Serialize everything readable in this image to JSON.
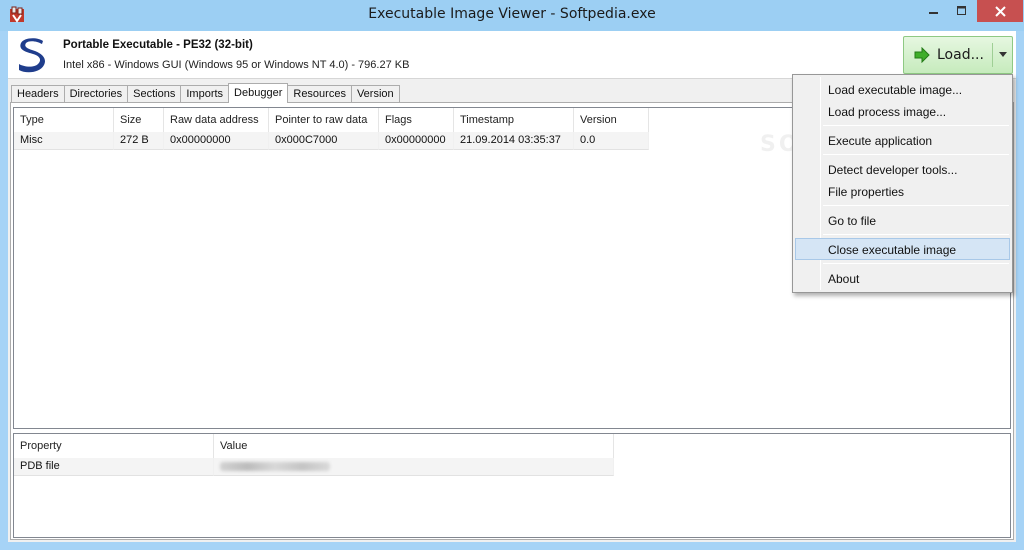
{
  "window": {
    "title": "Executable Image Viewer - Softpedia.exe"
  },
  "header": {
    "file_title": "Portable Executable - PE32 (32-bit)",
    "file_info": "Intel x86 - Windows GUI (Windows 95 or Windows NT 4.0) - 796.27 KB",
    "load_button": "Load..."
  },
  "tabs": [
    {
      "label": "Headers"
    },
    {
      "label": "Directories"
    },
    {
      "label": "Sections"
    },
    {
      "label": "Imports"
    },
    {
      "label": "Debugger"
    },
    {
      "label": "Resources"
    },
    {
      "label": "Version"
    }
  ],
  "active_tab": "Debugger",
  "debug_table": {
    "columns": [
      "Type",
      "Size",
      "Raw data address",
      "Pointer to raw data",
      "Flags",
      "Timestamp",
      "Version"
    ],
    "rows": [
      [
        "Misc",
        "272 B",
        "0x00000000",
        "0x000C7000",
        "0x00000000",
        "21.09.2014 03:35:37",
        "0.0"
      ]
    ]
  },
  "property_table": {
    "columns": [
      "Property",
      "Value"
    ],
    "rows": [
      [
        "PDB file",
        ""
      ]
    ]
  },
  "watermark": "SOFTPEDIA",
  "load_menu": {
    "items": [
      {
        "label": "Load executable image..."
      },
      {
        "label": "Load process image..."
      },
      {
        "label": "Execute application"
      },
      {
        "label": "Detect developer tools..."
      },
      {
        "label": "File properties"
      },
      {
        "label": "Go to file"
      },
      {
        "label": "Close executable image",
        "highlighted": true
      },
      {
        "label": "About"
      }
    ]
  },
  "colors": {
    "title_bar": "#9ccff3",
    "close_button": "#c75050",
    "load_button": "#c6ebbd",
    "logo": "#1f3d8c",
    "menu_highlight": "#d5e5f5"
  },
  "icons": [
    "app-icon",
    "minimize-icon",
    "maximize-icon",
    "close-icon",
    "softpedia-logo",
    "green-arrow-icon",
    "dropdown-arrow-icon"
  ]
}
